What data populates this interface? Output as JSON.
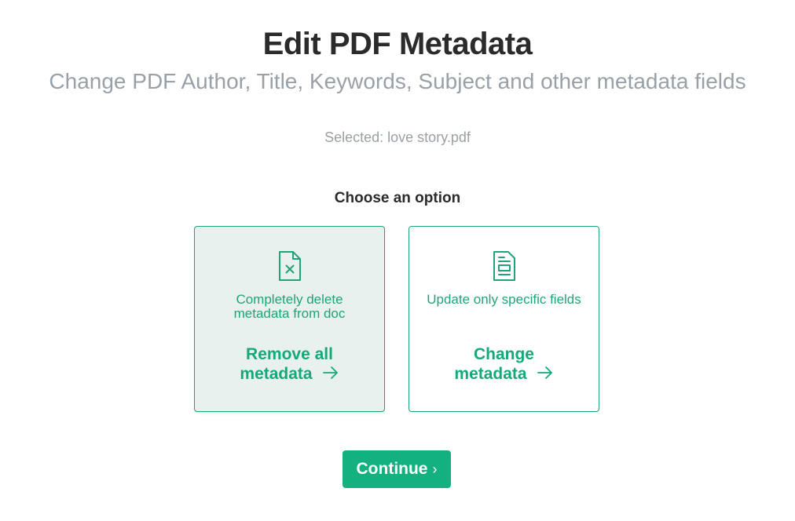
{
  "header": {
    "title": "Edit PDF Metadata",
    "subtitle": "Change PDF Author, Title, Keywords, Subject and other metadata fields"
  },
  "file": {
    "selected_text": "Selected: love story.pdf"
  },
  "options": {
    "heading": "Choose an option",
    "selected_option": "remove",
    "remove": {
      "icon": "document-x-icon",
      "description": "Completely delete metadata from doc",
      "action_line1": "Remove all",
      "action_line2": "metadata"
    },
    "change": {
      "icon": "document-form-icon",
      "description": "Update only specific fields",
      "action_line1": "Change",
      "action_line2": "metadata"
    }
  },
  "footer": {
    "continue_label": "Continue",
    "continue_icon": "chevron-right-icon"
  },
  "colors": {
    "accent": "#13b17f",
    "title": "#2b2b2b",
    "subtitle": "#99a1a8",
    "selected_card_bg": "#e9f1ee"
  }
}
